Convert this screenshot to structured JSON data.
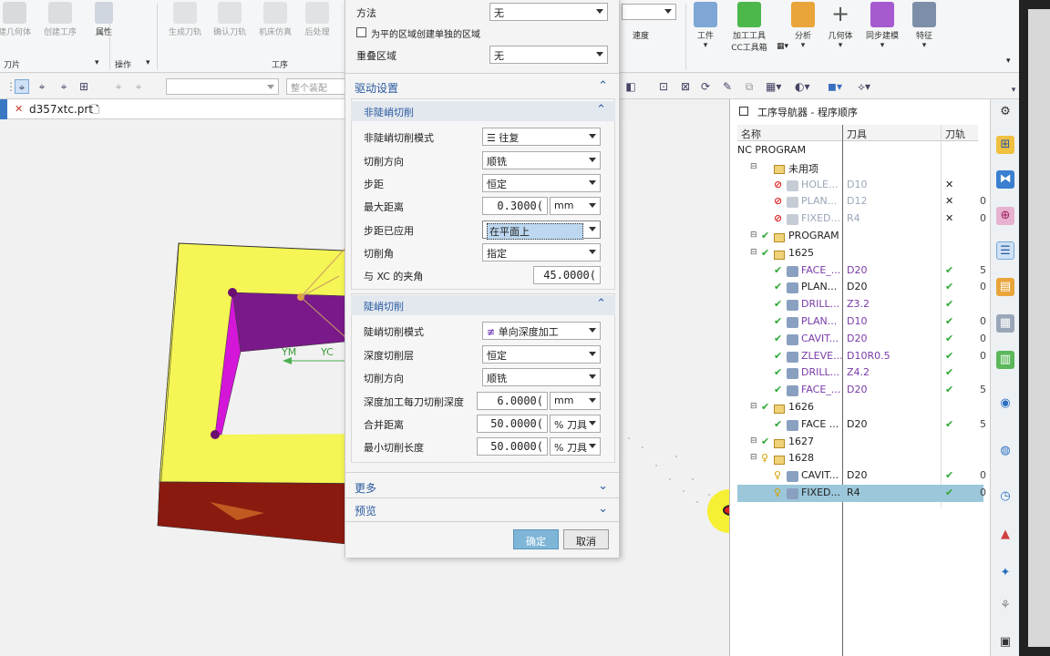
{
  "ribbon": {
    "buttons": [
      {
        "label": "建几何体",
        "icon": "geometry-icon",
        "dim": true
      },
      {
        "label": "创建工序",
        "icon": "create-operation-icon",
        "dim": true
      },
      {
        "label": "属性",
        "icon": "properties-icon",
        "dim": false
      },
      {
        "label": "生成刀轨",
        "icon": "generate-toolpath-icon",
        "dim": true
      },
      {
        "label": "确认刀轨",
        "icon": "verify-toolpath-icon",
        "dim": true
      },
      {
        "label": "机床仿真",
        "icon": "machine-sim-icon",
        "dim": true
      },
      {
        "label": "后处理",
        "icon": "postprocess-icon",
        "dim": true
      },
      {
        "label": "工件",
        "icon": "workpiece-icon",
        "dim": false
      },
      {
        "label": "加工工具",
        "label2": "CC工具箱",
        "icon": "machining-tools-icon",
        "dim": false
      },
      {
        "label": "分析",
        "icon": "analysis-icon",
        "dim": false
      },
      {
        "label": "几何体",
        "icon": "geometry-plus-icon",
        "dim": false
      },
      {
        "label": "同步建模",
        "icon": "sync-modeling-icon",
        "dim": false
      },
      {
        "label": "特征",
        "icon": "feature-icon",
        "dim": false
      }
    ],
    "speed_label": "速度",
    "groups": {
      "blade": "刀片",
      "operations": "操作",
      "process": "工序"
    }
  },
  "toolbar": {
    "filter_placeholder": "整个装配"
  },
  "file_tab": {
    "name": "d357xtc.prt"
  },
  "viewport": {
    "axis_ym": "YM",
    "axis_yc": "YC"
  },
  "dialog": {
    "top": {
      "method_label": "方法",
      "method_value": "无",
      "checkbox_label": "为平的区域创建单独的区域",
      "overlap_label": "重叠区域",
      "overlap_value": "无"
    },
    "drive_section": "驱动设置",
    "non_steep": {
      "header": "非陡峭切削",
      "mode_label": "非陡峭切削模式",
      "mode_value": "往复",
      "dir_label": "切削方向",
      "dir_value": "顺铣",
      "step_label": "步距",
      "step_value": "恒定",
      "maxdist_label": "最大距离",
      "maxdist_value": "0.3000(",
      "maxdist_unit": "mm",
      "apply_label": "步距已应用",
      "apply_value": "在平面上",
      "angle_label": "切削角",
      "angle_value": "指定",
      "xcangle_label": "与 XC 的夹角",
      "xcangle_value": "45.0000("
    },
    "steep": {
      "header": "陡峭切削",
      "mode_label": "陡峭切削模式",
      "mode_value": "单向深度加工",
      "depth_label": "深度切削层",
      "depth_value": "恒定",
      "dir_label": "切削方向",
      "dir_value": "顺铣",
      "perdepth_label": "深度加工每刀切削深度",
      "perdepth_value": "6.0000(",
      "perdepth_unit": "mm",
      "merge_label": "合并距离",
      "merge_value": "50.0000(",
      "merge_unit": "% 刀具",
      "minlen_label": "最小切削长度",
      "minlen_value": "50.0000(",
      "minlen_unit": "% 刀具"
    },
    "more": "更多",
    "preview": "预览",
    "ok": "确定",
    "cancel": "取消"
  },
  "navigator": {
    "title": "工序导航器 - 程序顺序",
    "col_name": "名称",
    "col_tool": "刀具",
    "col_path": "刀轨",
    "rows": [
      {
        "indent": 0,
        "name": "NC PROGRAM",
        "tool": "",
        "path": "",
        "status": "",
        "kind": "root",
        "extra": ""
      },
      {
        "indent": 1,
        "name": "未用项",
        "tool": "",
        "path": "",
        "status": "",
        "kind": "folder",
        "extra": ""
      },
      {
        "indent": 2,
        "name": "HOLE...",
        "tool": "D10",
        "path": "x",
        "status": "ban",
        "kind": "op-gray",
        "extra": ""
      },
      {
        "indent": 2,
        "name": "PLAN...",
        "tool": "D12",
        "path": "x",
        "status": "ban",
        "kind": "op-gray",
        "extra": "0"
      },
      {
        "indent": 2,
        "name": "FIXED...",
        "tool": "R4",
        "path": "x",
        "status": "ban",
        "kind": "op-gray",
        "extra": "0"
      },
      {
        "indent": 1,
        "name": "PROGRAM",
        "tool": "",
        "path": "",
        "status": "ok",
        "kind": "folder",
        "extra": ""
      },
      {
        "indent": 1,
        "name": "1625",
        "tool": "",
        "path": "",
        "status": "ok",
        "kind": "folder",
        "extra": ""
      },
      {
        "indent": 2,
        "name": "FACE_...",
        "tool": "D20",
        "path": "ok",
        "status": "ok",
        "kind": "op-purple",
        "extra": "5"
      },
      {
        "indent": 2,
        "name": "PLAN...",
        "tool": "D20",
        "path": "ok",
        "status": "ok",
        "kind": "op-black",
        "extra": "0"
      },
      {
        "indent": 2,
        "name": "DRILL...",
        "tool": "Z3.2",
        "path": "ok",
        "status": "ok",
        "kind": "op-purple",
        "extra": ""
      },
      {
        "indent": 2,
        "name": "PLAN...",
        "tool": "D10",
        "path": "ok",
        "status": "ok",
        "kind": "op-purple",
        "extra": "0"
      },
      {
        "indent": 2,
        "name": "CAVIT...",
        "tool": "D20",
        "path": "ok",
        "status": "ok",
        "kind": "op-purple",
        "extra": "0"
      },
      {
        "indent": 2,
        "name": "ZLEVE...",
        "tool": "D10R0.5",
        "path": "ok",
        "status": "ok",
        "kind": "op-purple",
        "extra": "0"
      },
      {
        "indent": 2,
        "name": "DRILL...",
        "tool": "Z4.2",
        "path": "ok",
        "status": "ok",
        "kind": "op-purple",
        "extra": ""
      },
      {
        "indent": 2,
        "name": "FACE_...",
        "tool": "D20",
        "path": "ok",
        "status": "ok",
        "kind": "op-purple",
        "extra": "5"
      },
      {
        "indent": 1,
        "name": "1626",
        "tool": "",
        "path": "",
        "status": "ok",
        "kind": "folder",
        "extra": ""
      },
      {
        "indent": 2,
        "name": "FACE ...",
        "tool": "D20",
        "path": "ok",
        "status": "ok",
        "kind": "op-black",
        "extra": "5"
      },
      {
        "indent": 1,
        "name": "1627",
        "tool": "",
        "path": "",
        "status": "ok",
        "kind": "folder",
        "extra": ""
      },
      {
        "indent": 1,
        "name": "1628",
        "tool": "",
        "path": "",
        "status": "warn",
        "kind": "folder",
        "extra": ""
      },
      {
        "indent": 2,
        "name": "CAVIT...",
        "tool": "D20",
        "path": "ok",
        "status": "warn",
        "kind": "op-black",
        "extra": "0"
      },
      {
        "indent": 2,
        "name": "FIXED...",
        "tool": "R4",
        "path": "ok",
        "status": "warn",
        "kind": "op-black",
        "extra": "0",
        "selected": true
      }
    ]
  },
  "colors": {
    "accent": "#2a5aa0",
    "check": "#2fa836",
    "selected_row": "#9cc7da",
    "part_yellow": "#f5f555",
    "part_purple": "#7a1a8a",
    "part_red": "#8a1a10"
  }
}
